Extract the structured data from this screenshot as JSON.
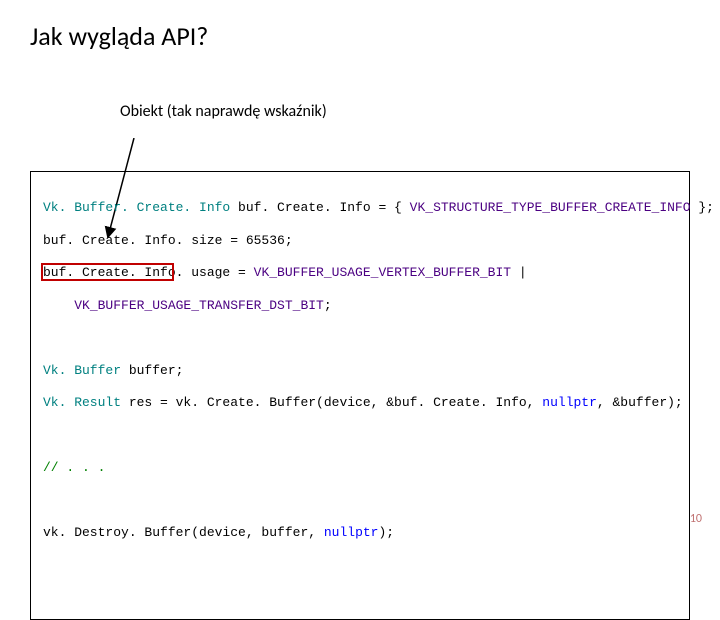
{
  "title": "Jak wygląda API?",
  "annotation": "Obiekt (tak naprawdę wskaźnik)",
  "code": {
    "type_VkBufferCreateInfo": "Vk. Buffer. Create. Info",
    "var_bufCreateInfo": " buf. Create. Info = { ",
    "enum_structType": "VK_STRUCTURE_TYPE_BUFFER_CREATE_INFO",
    "line1_end": " };",
    "line2": "buf. Create. Info. size = 65536;",
    "line3a": "buf. Create. Info. usage = ",
    "enum_vertexBit": "VK_BUFFER_USAGE_VERTEX_BUFFER_BIT",
    "line3b": " |",
    "line4_indent": "    ",
    "enum_transferDst": "VK_BUFFER_USAGE_TRANSFER_DST_BIT",
    "line4_end": ";",
    "type_VkBuffer": "Vk. Buffer",
    "var_buffer": " buffer;",
    "type_VkResult": "Vk. Result",
    "line6_rest": " res = vk. Create. Buffer(device, &buf. Create. Info, ",
    "kw_nullptr": "nullptr",
    "line6_end": ", &buffer);",
    "comment_ellipsis": "// . . .",
    "line8a": "vk. Destroy. Buffer(device, buffer, ",
    "line8_end": ");"
  },
  "page_number": "10"
}
